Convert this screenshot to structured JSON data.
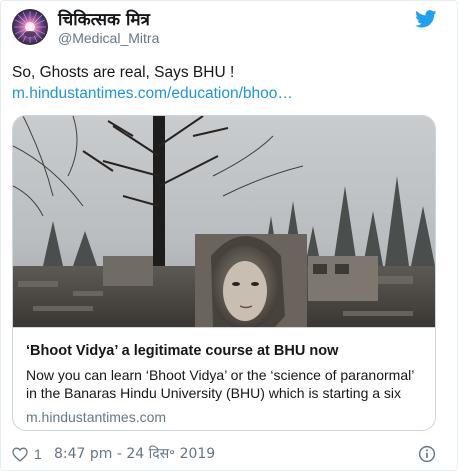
{
  "user": {
    "display_name": "चिकित्सक मित्र",
    "handle": "@Medical_Mitra",
    "avatar_icon": "avatar-image"
  },
  "tweet": {
    "text": "So, Ghosts are real, Says BHU !",
    "link_text": "m.hindustantimes.com/education/bhoo…"
  },
  "card": {
    "title": "‘Bhoot Vidya’ a legitimate course at BHU now",
    "description_lines": [
      "Now you can learn ‘Bhoot Vidya’ or the ‘science of paranormal’",
      "in the Banaras Hindu University (BHU) which is starting a six"
    ],
    "domain": "m.hindustantimes.com"
  },
  "footer": {
    "like_count": "1",
    "timestamp": "8:47 pm - 24 दिस॰ 2019",
    "heart_icon": "heart-icon",
    "info_icon": "info-icon"
  },
  "colors": {
    "link": "#1b95e0",
    "secondary_text": "#657786",
    "border": "#ccd6dd",
    "twitter_blue": "#1da1f2"
  }
}
